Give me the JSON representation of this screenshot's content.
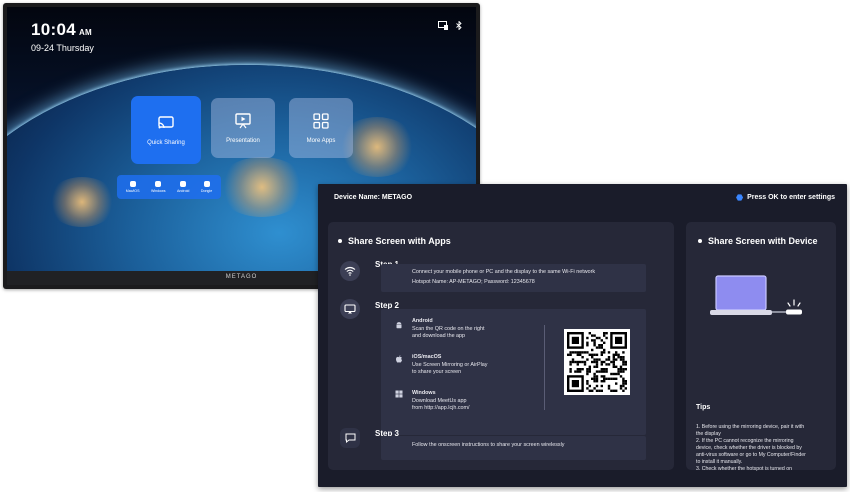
{
  "tv": {
    "time": "10:04",
    "ampm": "AM",
    "date": "09-24 Thursday",
    "brand": "METAGO",
    "tiles": [
      {
        "label": "Quick Sharing",
        "icon": "cast-icon"
      },
      {
        "label": "Presentation",
        "icon": "presentation-icon"
      },
      {
        "label": "More Apps",
        "icon": "grid-icon"
      }
    ],
    "sub_tiles": [
      "Mac/iOS",
      "Windows",
      "Android",
      "Dongle"
    ],
    "status_icons": [
      "screen-icon",
      "bluetooth-icon"
    ]
  },
  "panel": {
    "device_name": "Device Name: METAGO",
    "settings_hint": "Press OK to enter settings",
    "left_card": {
      "title": "Share Screen with Apps",
      "step1": {
        "label": "Step  1",
        "line1": "Connect your mobile phone or PC and the display to the same Wi-Fi network",
        "line2": "Hotspot Name: AP-METAGO;  Password: 12345678"
      },
      "step2": {
        "label": "Step  2",
        "android_title": "Android",
        "android_line1": "Scan the QR code on the right",
        "android_line2": " and download the app",
        "ios_title": "iOS/macOS",
        "ios_line1": "Use Screen Mirroring or AirPlay",
        "ios_line2": " to share your screen",
        "win_title": "Windows",
        "win_line1": "Download MeetUs app",
        "win_line2": "from http://app.lcjh.com/"
      },
      "step3": {
        "label": "Step  3",
        "line1": "Follow the onscreen instructions to share your screen wirelessly"
      }
    },
    "right_card": {
      "title": "Share Screen with Device",
      "tips_title": "Tips",
      "tip1a": "1. Before using the mirroring device, pair it with",
      "tip1b": "the display",
      "tip2a": "2. If the PC cannot recognize the mirroring",
      "tip2b": "device, check whether the driver is blocked by",
      "tip2c": "anti-virus software or go to My Computer/Finder",
      "tip2d": "to install it manually.",
      "tip3": "3. Check whether the hotspot is turned on"
    }
  },
  "colors": {
    "panel_bg": "#1a1c2a",
    "card_bg": "#262838",
    "accent": "#1e6ff0",
    "laptop": "#8e8cf0"
  }
}
